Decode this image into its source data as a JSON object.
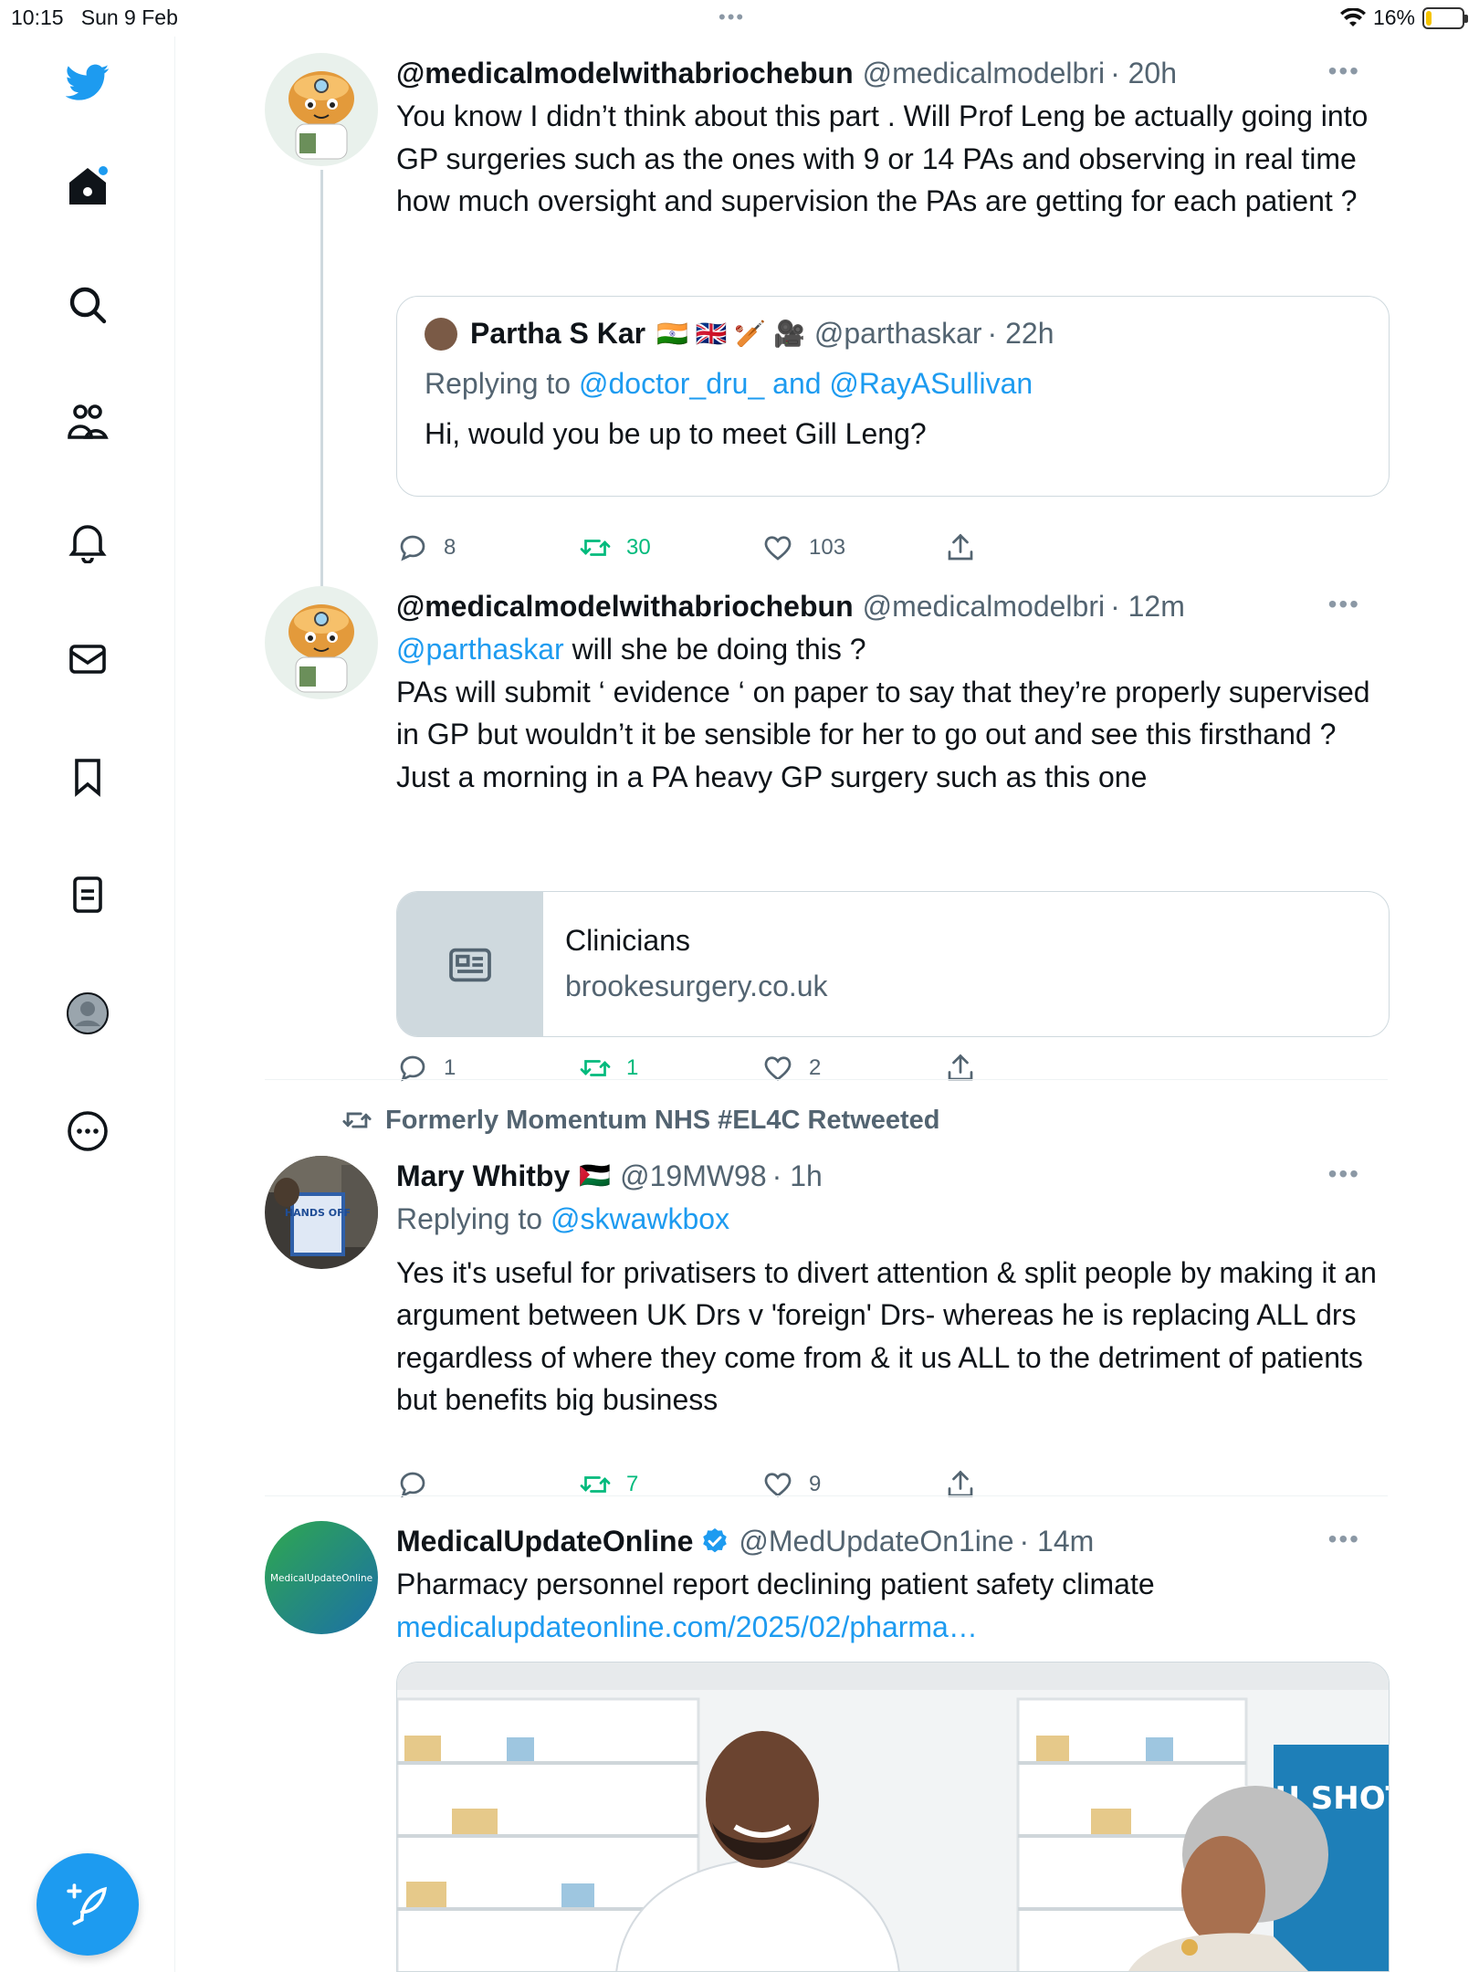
{
  "status_bar": {
    "time": "10:15",
    "date": "Sun 9 Feb",
    "battery": "16%",
    "battery_level": 0.16
  },
  "sidebar": {
    "items": [
      "twitter-logo",
      "home",
      "search",
      "communities",
      "notifications",
      "messages",
      "bookmarks",
      "lists",
      "profile",
      "more"
    ]
  },
  "tweets": [
    {
      "name": "@medicalmodelwithabriochebun",
      "handle": "@medicalmodelbri",
      "time": "· 20h",
      "text": "You know I didn’t think about this part . Will Prof Leng be actually going into GP surgeries such as the ones with 9 or 14 PAs and observing  in real time how much oversight and supervision the PAs are getting for each patient ?",
      "quote": {
        "name": "Partha S Kar",
        "emojis": "🇮🇳 🇬🇧 🏏 🎥",
        "handle": "@parthaskar",
        "time": "· 22h",
        "replying_prefix": "Replying to",
        "replying_to": "@doctor_dru_ and @RayASullivan",
        "text": "Hi, would you be up to meet Gill Leng?"
      },
      "replies": "8",
      "retweets": "30",
      "likes": "103"
    },
    {
      "name": "@medicalmodelwithabriochebun",
      "handle": "@medicalmodelbri",
      "time": "· 12m",
      "mention": "@parthaskar",
      "text_line1": " will she be doing this ?",
      "text": "PAs will submit ‘ evidence ‘ on paper to say  that they’re properly supervised in GP but wouldn’t it be sensible for her to go out and see this firsthand ? Just a morning in a PA heavy GP surgery such as this one",
      "card": {
        "title": "Clinicians",
        "domain": "brookesurgery.co.uk"
      },
      "replies": "1",
      "retweets": "1",
      "likes": "2"
    },
    {
      "retweeted_by": "Formerly Momentum NHS #EL4C Retweeted",
      "name": "Mary Whitby",
      "flag": "🇵🇸",
      "handle": "@19MW98",
      "time": "· 1h",
      "replying_prefix": "Replying to",
      "replying_to": "@skwawkbox",
      "text": "Yes it's useful for privatisers to divert attention & split people by making it an argument between UK Drs v 'foreign' Drs- whereas he is replacing ALL drs regardless of where they come from & it us ALL to the detriment of patients but benefits big business",
      "avatar_text": "HANDS OFF",
      "replies": "",
      "retweets": "7",
      "likes": "9"
    },
    {
      "name": "MedicalUpdateOnline",
      "handle": "@MedUpdateOn1ine",
      "time": "· 14m",
      "text": "Pharmacy personnel report declining patient safety climate",
      "link": "medicalupdateonline.com/2025/02/pharma…",
      "avatar_text": "MedicalUpdateOnline",
      "media_sign": "FLU SHOTS"
    }
  ],
  "more_label": "•••"
}
